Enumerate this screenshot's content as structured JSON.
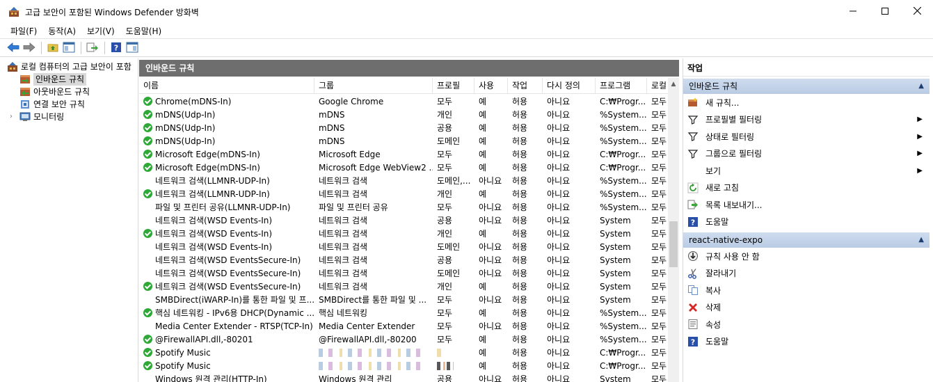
{
  "window": {
    "title": "고급 보안이 포함된 Windows Defender 방화벽",
    "minimize_icon": "minimize-icon",
    "maximize_icon": "maximize-icon",
    "close_icon": "close-icon"
  },
  "menu": {
    "items": [
      "파일(F)",
      "동작(A)",
      "보기(V)",
      "도움말(H)"
    ]
  },
  "toolbar": {
    "icons": [
      "back-arrow-icon",
      "forward-arrow-icon",
      "up-folder-icon",
      "show-hide-tree-icon",
      "export-icon",
      "help-icon",
      "show-hide-action-icon"
    ]
  },
  "tree": {
    "root_label": "로컬 컴퓨터의 고급 보안이 포함",
    "items": [
      {
        "label": "인바운드 규칙",
        "selected": true
      },
      {
        "label": "아웃바운드 규칙",
        "selected": false
      },
      {
        "label": "연결 보안 규칙",
        "selected": false
      },
      {
        "label": "모니터링",
        "selected": false
      }
    ]
  },
  "center": {
    "header": "인바운드 규칙",
    "columns": [
      "이름",
      "그룹",
      "프로필",
      "사용",
      "작업",
      "다시 정의",
      "프로그램",
      "로컬"
    ],
    "rows": [
      {
        "enabled_icon": true,
        "name": "Chrome(mDNS-In)",
        "group": "Google Chrome",
        "profile": "모두",
        "enabled": "예",
        "action": "허용",
        "override": "아니요",
        "program": "C:₩Progr...",
        "local": "모두"
      },
      {
        "enabled_icon": true,
        "name": "mDNS(Udp-In)",
        "group": "mDNS",
        "profile": "개인",
        "enabled": "예",
        "action": "허용",
        "override": "아니요",
        "program": "%System...",
        "local": "모두"
      },
      {
        "enabled_icon": true,
        "name": "mDNS(Udp-In)",
        "group": "mDNS",
        "profile": "공용",
        "enabled": "예",
        "action": "허용",
        "override": "아니요",
        "program": "%System...",
        "local": "모두"
      },
      {
        "enabled_icon": true,
        "name": "mDNS(Udp-In)",
        "group": "mDNS",
        "profile": "도메인",
        "enabled": "예",
        "action": "허용",
        "override": "아니요",
        "program": "%System...",
        "local": "모두"
      },
      {
        "enabled_icon": true,
        "name": "Microsoft Edge(mDNS-In)",
        "group": "Microsoft Edge",
        "profile": "모두",
        "enabled": "예",
        "action": "허용",
        "override": "아니요",
        "program": "C:₩Progr...",
        "local": "모두"
      },
      {
        "enabled_icon": true,
        "name": "Microsoft Edge(mDNS-In)",
        "group": "Microsoft Edge WebView2 ...",
        "profile": "모두",
        "enabled": "예",
        "action": "허용",
        "override": "아니요",
        "program": "C:₩Progr...",
        "local": "모두"
      },
      {
        "enabled_icon": false,
        "name": "네트워크 검색(LLMNR-UDP-In)",
        "group": "네트워크 검색",
        "profile": "도메인,...",
        "enabled": "아니요",
        "action": "허용",
        "override": "아니요",
        "program": "%System...",
        "local": "모두"
      },
      {
        "enabled_icon": true,
        "name": "네트워크 검색(LLMNR-UDP-In)",
        "group": "네트워크 검색",
        "profile": "개인",
        "enabled": "예",
        "action": "허용",
        "override": "아니요",
        "program": "%System...",
        "local": "모두"
      },
      {
        "enabled_icon": false,
        "name": "파일 및 프린터 공유(LLMNR-UDP-In)",
        "group": "파일 및 프린터 공유",
        "profile": "모두",
        "enabled": "아니요",
        "action": "허용",
        "override": "아니요",
        "program": "%System...",
        "local": "모두"
      },
      {
        "enabled_icon": false,
        "name": "네트워크 검색(WSD Events-In)",
        "group": "네트워크 검색",
        "profile": "공용",
        "enabled": "아니요",
        "action": "허용",
        "override": "아니요",
        "program": "System",
        "local": "모두"
      },
      {
        "enabled_icon": true,
        "name": "네트워크 검색(WSD Events-In)",
        "group": "네트워크 검색",
        "profile": "개인",
        "enabled": "예",
        "action": "허용",
        "override": "아니요",
        "program": "System",
        "local": "모두"
      },
      {
        "enabled_icon": false,
        "name": "네트워크 검색(WSD Events-In)",
        "group": "네트워크 검색",
        "profile": "도메인",
        "enabled": "아니요",
        "action": "허용",
        "override": "아니요",
        "program": "System",
        "local": "모두"
      },
      {
        "enabled_icon": false,
        "name": "네트워크 검색(WSD EventsSecure-In)",
        "group": "네트워크 검색",
        "profile": "공용",
        "enabled": "아니요",
        "action": "허용",
        "override": "아니요",
        "program": "System",
        "local": "모두"
      },
      {
        "enabled_icon": false,
        "name": "네트워크 검색(WSD EventsSecure-In)",
        "group": "네트워크 검색",
        "profile": "도메인",
        "enabled": "아니요",
        "action": "허용",
        "override": "아니요",
        "program": "System",
        "local": "모두"
      },
      {
        "enabled_icon": true,
        "name": "네트워크 검색(WSD EventsSecure-In)",
        "group": "네트워크 검색",
        "profile": "개인",
        "enabled": "예",
        "action": "허용",
        "override": "아니요",
        "program": "System",
        "local": "모두"
      },
      {
        "enabled_icon": false,
        "name": "SMBDirect(iWARP-In)를 통한 파일 및 프...",
        "group": "SMBDirect를 통한 파일 및 ...",
        "profile": "모두",
        "enabled": "아니요",
        "action": "허용",
        "override": "아니요",
        "program": "System",
        "local": "모두"
      },
      {
        "enabled_icon": true,
        "name": "핵심 네트워킹 - IPv6용 DHCP(Dynamic ...",
        "group": "핵심 네트워킹",
        "profile": "모두",
        "enabled": "예",
        "action": "허용",
        "override": "아니요",
        "program": "%System...",
        "local": "모두"
      },
      {
        "enabled_icon": false,
        "name": "Media Center Extender - RTSP(TCP-In)",
        "group": "Media Center Extender",
        "profile": "모두",
        "enabled": "아니요",
        "action": "허용",
        "override": "아니요",
        "program": "%System...",
        "local": "모두"
      },
      {
        "enabled_icon": true,
        "name": "@FirewallAPI.dll,-80201",
        "group": "@FirewallAPI.dll,-80200",
        "profile": "모두",
        "enabled": "예",
        "action": "허용",
        "override": "아니요",
        "program": "%System...",
        "local": "모두"
      },
      {
        "enabled_icon": true,
        "name": "Spotify Music",
        "group": "",
        "redacted_group": true,
        "profile": "",
        "enabled": "예",
        "action": "허용",
        "override": "아니요",
        "program": "C:₩Progr...",
        "local": "모두"
      },
      {
        "enabled_icon": true,
        "name": "Spotify Music",
        "group": "",
        "redacted_group": true,
        "redacted_profile": true,
        "profile": "",
        "enabled": "예",
        "action": "허용",
        "override": "아니요",
        "program": "C:₩Progr...",
        "local": "모두"
      },
      {
        "enabled_icon": false,
        "name": "Windows 원격 관리(HTTP-In)",
        "group": "Windows 원격 관리",
        "profile": "공용",
        "enabled": "아니요",
        "action": "허용",
        "override": "아니요",
        "program": "System",
        "local": "모두"
      }
    ]
  },
  "actions": {
    "title": "작업",
    "sections": [
      {
        "header": "인바운드 규칙",
        "items": [
          {
            "label": "새 규칙...",
            "icon": "new-rule-icon",
            "submenu": false
          },
          {
            "label": "프로필별 필터링",
            "icon": "filter-icon",
            "submenu": true
          },
          {
            "label": "상태로 필터링",
            "icon": "filter-icon",
            "submenu": true
          },
          {
            "label": "그룹으로 필터링",
            "icon": "filter-icon",
            "submenu": true
          },
          {
            "label": "보기",
            "icon": "",
            "submenu": true
          },
          {
            "label": "새로 고침",
            "icon": "refresh-icon",
            "submenu": false
          },
          {
            "label": "목록 내보내기...",
            "icon": "export-list-icon",
            "submenu": false
          },
          {
            "label": "도움말",
            "icon": "help-icon",
            "submenu": false
          }
        ]
      },
      {
        "header": "react-native-expo",
        "items": [
          {
            "label": "규칙 사용 안 함",
            "icon": "disable-rule-icon",
            "submenu": false
          },
          {
            "label": "잘라내기",
            "icon": "cut-icon",
            "submenu": false
          },
          {
            "label": "복사",
            "icon": "copy-icon",
            "submenu": false
          },
          {
            "label": "삭제",
            "icon": "delete-icon",
            "submenu": false
          },
          {
            "label": "속성",
            "icon": "properties-icon",
            "submenu": false
          },
          {
            "label": "도움말",
            "icon": "help-icon",
            "submenu": false
          }
        ]
      }
    ]
  },
  "colors": {
    "center_header_bg": "#6e6e6e",
    "section_header_bg": "#c3d2e6",
    "enabled_green": "#2ea836",
    "selected_tree_bg": "#d9d9d9"
  }
}
